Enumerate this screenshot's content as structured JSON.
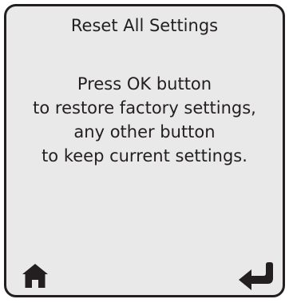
{
  "screen": {
    "title": "Reset All Settings",
    "message_lines": [
      "Press OK button",
      "to restore factory settings,",
      "any other button",
      "to keep current settings."
    ]
  },
  "footer": {
    "home_icon": "home-icon",
    "back_icon": "return-arrow-icon"
  },
  "colors": {
    "background": "#e9e9e9",
    "border": "#231f20",
    "text": "#231f20"
  }
}
